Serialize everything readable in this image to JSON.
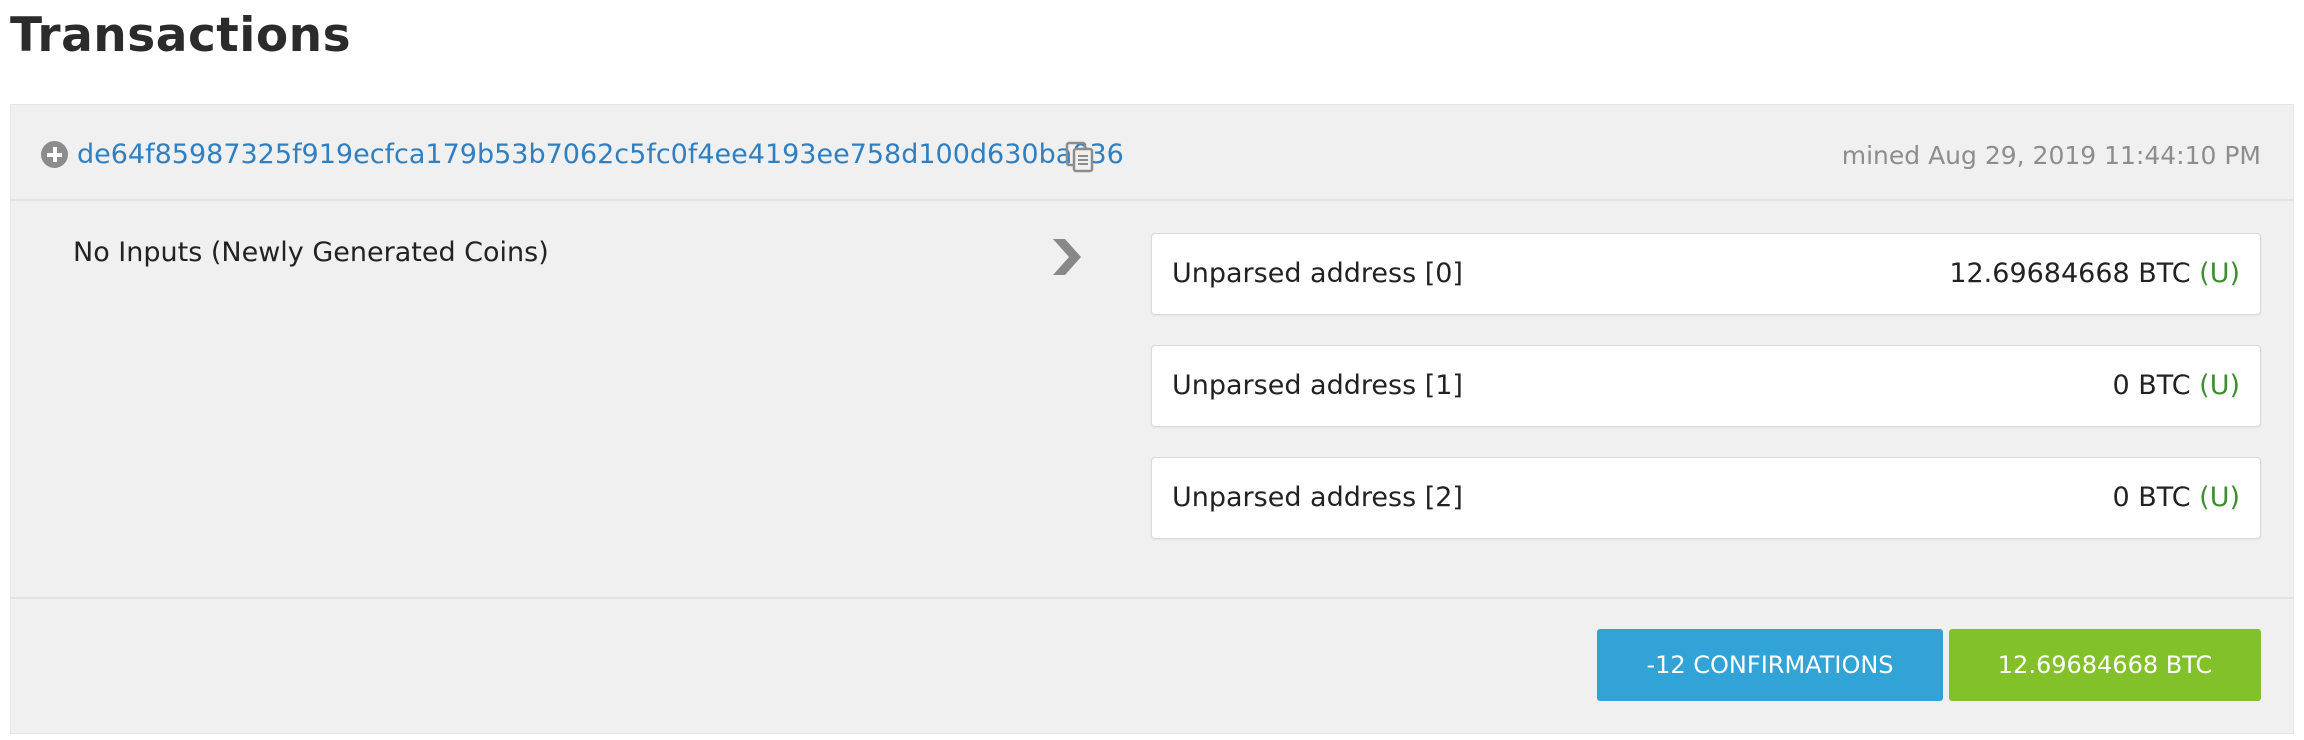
{
  "page": {
    "title": "Transactions"
  },
  "transaction": {
    "hash": "de64f85987325f919ecfca179b53b7062c5fc0f4ee4193ee758d100d630ba036",
    "mined": "mined Aug 29, 2019 11:44:10 PM",
    "inputs_text": "No Inputs (Newly Generated Coins)",
    "outputs": [
      {
        "address": "Unparsed address [0]",
        "amount": "12.69684668 BTC",
        "flag": "(U)"
      },
      {
        "address": "Unparsed address [1]",
        "amount": "0 BTC",
        "flag": "(U)"
      },
      {
        "address": "Unparsed address [2]",
        "amount": "0 BTC",
        "flag": "(U)"
      }
    ],
    "confirmations_label": "-12 CONFIRMATIONS",
    "total_label": "12.69684668 BTC"
  },
  "colors": {
    "link": "#2f7fc1",
    "confirm_button": "#31a3d6",
    "amount_button": "#83c12a",
    "unspent_flag": "#3c8f2f"
  },
  "icons": {
    "expand": "plus-circle-icon",
    "copy": "copy-icon",
    "arrow": "chevron-right-icon"
  }
}
